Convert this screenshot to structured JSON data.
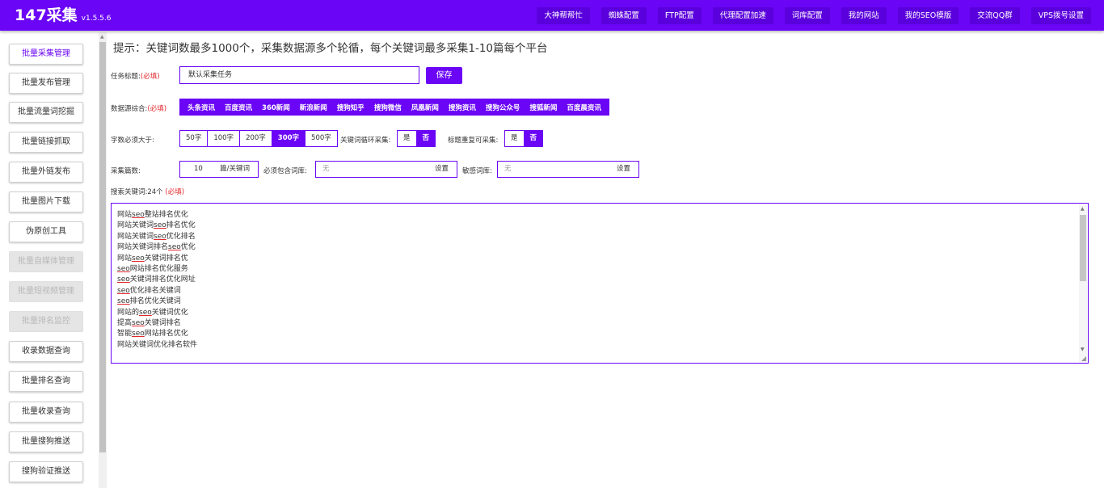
{
  "header": {
    "brand": "147采集",
    "version": "v1.5.5.6",
    "nav": [
      "大神帮帮忙",
      "蜘蛛配置",
      "FTP配置",
      "代理配置加速",
      "词库配置",
      "我的网站",
      "我的SEO模版",
      "交流QQ群",
      "VPS拨号设置"
    ]
  },
  "sidebar": {
    "items": [
      {
        "label": "批量采集管理",
        "state": "active"
      },
      {
        "label": "批量发布管理",
        "state": "normal"
      },
      {
        "label": "批量流量词挖掘",
        "state": "normal"
      },
      {
        "label": "批量链接抓取",
        "state": "normal"
      },
      {
        "label": "批量外链发布",
        "state": "normal"
      },
      {
        "label": "批量图片下载",
        "state": "normal"
      },
      {
        "label": "伪原创工具",
        "state": "normal"
      },
      {
        "label": "批量自媒体管理",
        "state": "disabled"
      },
      {
        "label": "批量短视频管理",
        "state": "disabled"
      },
      {
        "label": "批量排名监控",
        "state": "disabled"
      },
      {
        "label": "收录数据查询",
        "state": "normal"
      },
      {
        "label": "批量排名查询",
        "state": "normal"
      },
      {
        "label": "批量收录查询",
        "state": "normal"
      },
      {
        "label": "批量搜狗推送",
        "state": "normal"
      },
      {
        "label": "搜狗验证推送",
        "state": "normal"
      }
    ]
  },
  "main": {
    "hint": "提示：关键词数最多1000个，采集数据源多个轮循，每个关键词最多采集1-10篇每个平台",
    "task_title": {
      "label": "任务标题:",
      "required": "(必填)",
      "value": "默认采集任务",
      "save_label": "保存"
    },
    "sources": {
      "label": "数据源综合:",
      "required": "(必填)",
      "options": [
        "头条资讯",
        "百度资讯",
        "360新闻",
        "新浪新闻",
        "搜狗知乎",
        "搜狗微信",
        "凤凰新闻",
        "搜狗资讯",
        "搜狗公众号",
        "搜狐新闻",
        "百度晨资讯"
      ]
    },
    "min_words": {
      "label": "字数必须大于:",
      "options": [
        "50字",
        "100字",
        "200字",
        "300字",
        "500字"
      ],
      "selected": "300字"
    },
    "keyword_loop": {
      "label": "关键词循环采集:",
      "options": [
        "是",
        "否"
      ],
      "selected": "否"
    },
    "title_repeat": {
      "label": "标题重复可采集:",
      "options": [
        "是",
        "否"
      ],
      "selected": "否"
    },
    "collect_count": {
      "label": "采集篇数:",
      "value": "10",
      "unit": "篇/关键词"
    },
    "must_include": {
      "label": "必须包含词库:",
      "value": "无",
      "action": "设置"
    },
    "sensitive": {
      "label": "敏感词库:",
      "value": "无",
      "action": "设置"
    },
    "keywords": {
      "label": "搜索关键词:24个",
      "required": "(必填)",
      "lines": [
        "网站seo整站排名优化",
        "网站关键词seo排名优化",
        "网站关键词seo优化排名",
        "网站关键词排名seo优化",
        "网站seo关键词排名优",
        "seo网站排名优化服务",
        "seo关键词排名优化网址",
        "seo优化排名关键词",
        "seo排名优化关键词",
        "网站的seo关键词优化",
        "提高seo关键词排名",
        "智能seo网站排名优化",
        "网站关键词优化排名软件"
      ]
    }
  },
  "colors": {
    "accent": "#6a05f5",
    "required": "#e3262a",
    "disabled_bg": "#e5e5e5"
  }
}
